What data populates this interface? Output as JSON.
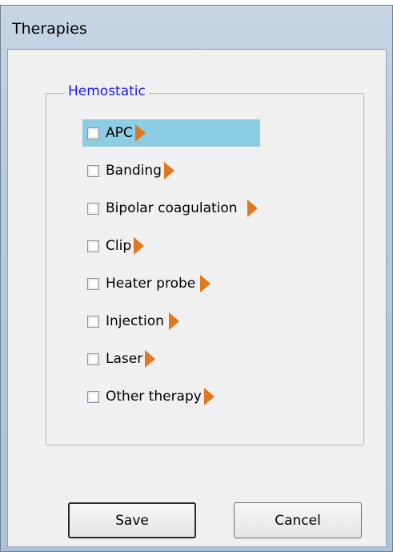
{
  "window": {
    "title": "Therapies"
  },
  "group": {
    "label": "Hemostatic"
  },
  "items": [
    {
      "label": "APC",
      "selected": true
    },
    {
      "label": "Banding"
    },
    {
      "label": "Bipolar coagulation"
    },
    {
      "label": "Clip"
    },
    {
      "label": "Heater probe"
    },
    {
      "label": "Injection"
    },
    {
      "label": "Laser"
    },
    {
      "label": "Other therapy"
    }
  ],
  "buttons": {
    "save": "Save",
    "cancel": "Cancel"
  },
  "colors": {
    "accent_arrow": "#e0791d",
    "selection": "#8ccde4",
    "group_label": "#1a1af0"
  }
}
